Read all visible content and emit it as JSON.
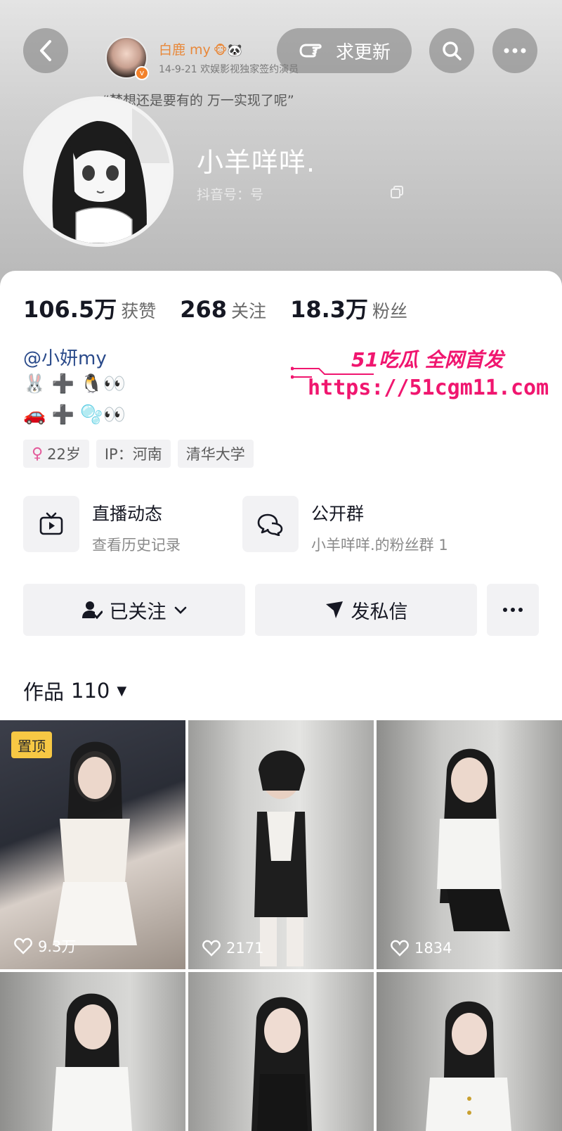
{
  "header": {
    "pill_button_label": "求更新",
    "mini_profile": {
      "name": "白鹿 my",
      "name_emoji": "🐵🐼",
      "desc": "14-9-21  欢娱影视独家签约演员",
      "quote": "“梦想还是要有的 万一实现了呢”"
    },
    "nickname": "小羊咩咩.",
    "douyin_id_label": "抖音号：",
    "douyin_id_value": "号"
  },
  "stats": [
    {
      "num": "106.5万",
      "label": "获赞"
    },
    {
      "num": "268",
      "label": "关注"
    },
    {
      "num": "18.3万",
      "label": "粉丝"
    }
  ],
  "bio": {
    "mention": "@小妍my",
    "line1": "🐰 ➕ 🐧👀",
    "line2": "🚗 ➕ 🫧👀"
  },
  "tags": {
    "gender_icon": "♀",
    "age": "22岁",
    "ip": "IP：河南",
    "school": "清华大学"
  },
  "features": {
    "live": {
      "title": "直播动态",
      "subtitle": "查看历史记录"
    },
    "group": {
      "title": "公开群",
      "subtitle": "小羊咩咩.的粉丝群 1"
    }
  },
  "actions": {
    "followed_label": "已关注",
    "message_label": "发私信"
  },
  "works": {
    "label": "作品",
    "count": "110"
  },
  "watermark": {
    "top": "51吃瓜 全网首发",
    "url": "https://51cgm11.com"
  },
  "videos": [
    {
      "likes": "9.3万",
      "pinned_label": "置顶"
    },
    {
      "likes": "2171"
    },
    {
      "likes": "1834"
    },
    {
      "likes": ""
    },
    {
      "likes": ""
    },
    {
      "likes": ""
    }
  ],
  "colors": {
    "accent_pink": "#f0166f",
    "pin_badge": "#f7c844",
    "mention_blue": "#2a4a8a"
  }
}
